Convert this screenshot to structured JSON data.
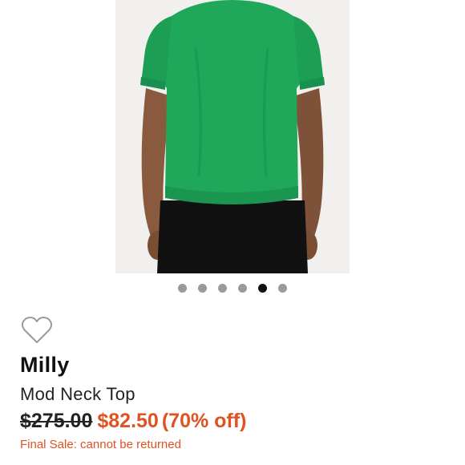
{
  "product": {
    "brand": "Milly",
    "title": "Mod Neck Top",
    "original_price": "$275.00",
    "sale_price": "$82.50",
    "discount": "(70% off)",
    "final_sale_note": "Final Sale: cannot be returned"
  },
  "gallery": {
    "image_icon": "product-photo",
    "total_images": 6,
    "active_index": 4,
    "garment_color": "#1fa85a",
    "bottom_color": "#111111"
  },
  "actions": {
    "like_icon": "heart-outline-icon"
  },
  "colors": {
    "accent": "#e0521f",
    "dot_inactive": "#9a9a9a",
    "dot_active": "#111111"
  }
}
